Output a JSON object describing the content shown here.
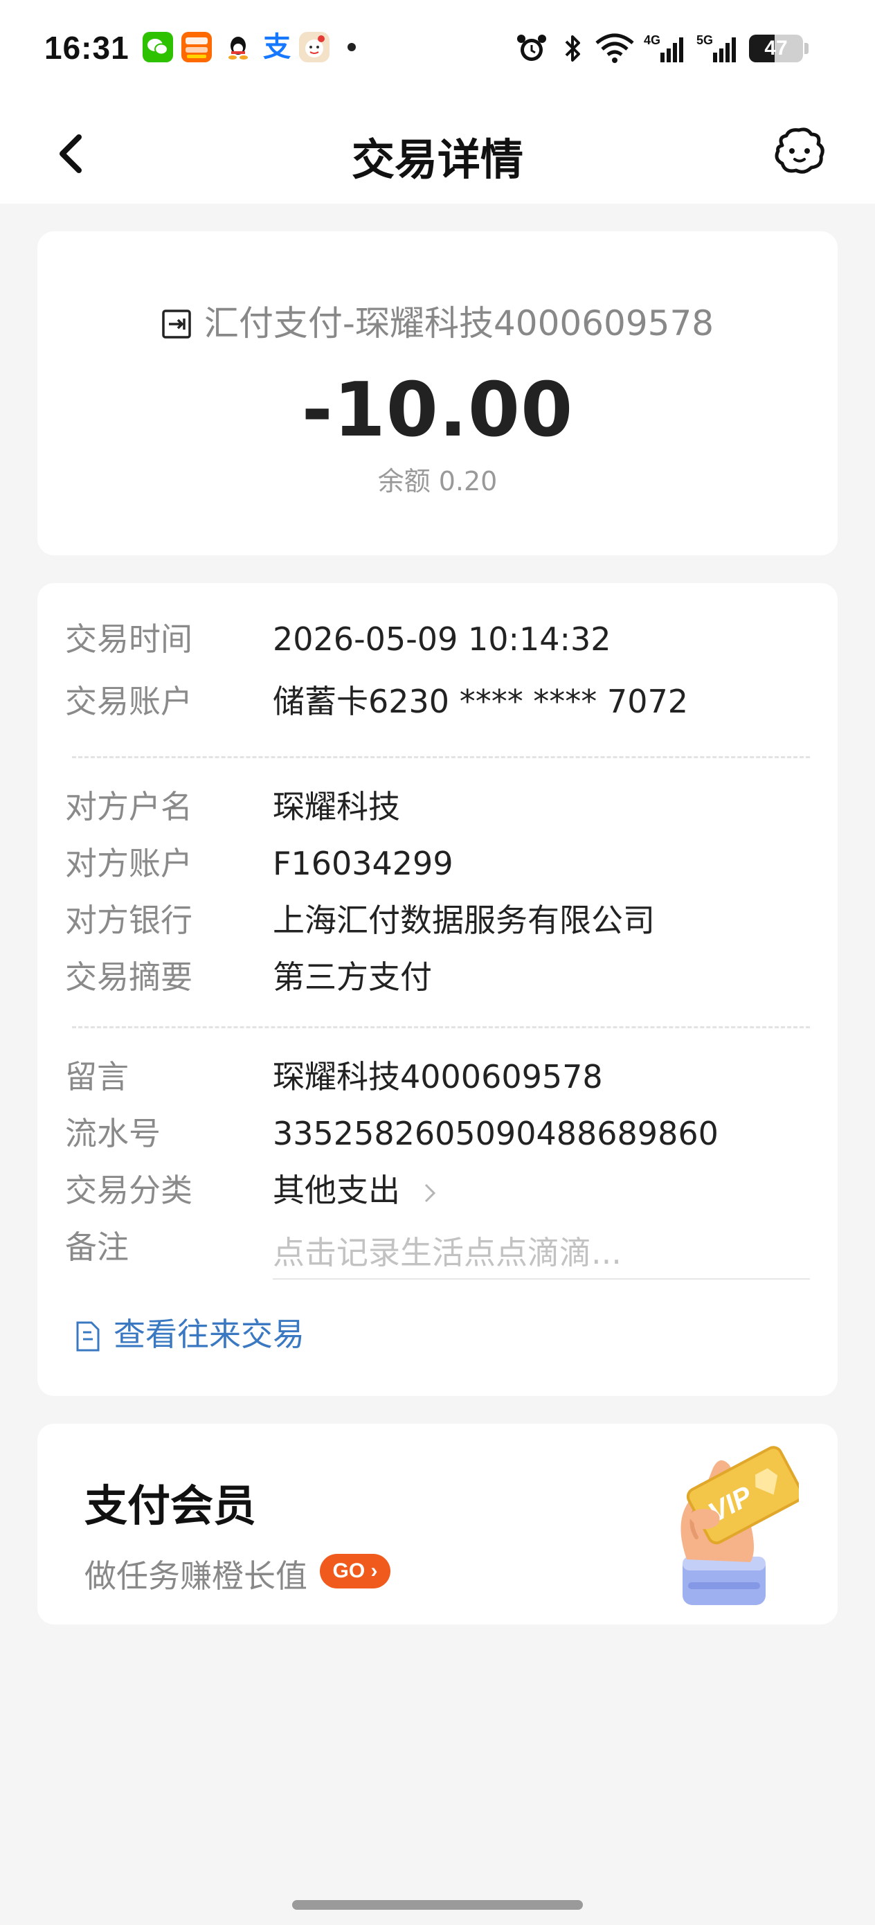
{
  "status_bar": {
    "time": "16:31",
    "battery_level": "47",
    "battery_fraction": 0.47,
    "notification_icons": [
      "wechat-icon",
      "taobao-icon",
      "qq-icon",
      "alipay-icon",
      "app-icon",
      "more-dot"
    ],
    "system_icons": [
      "alarm-icon",
      "bluetooth-icon",
      "wifi-icon",
      "signal-4g-icon",
      "signal-5g-icon",
      "battery-icon"
    ],
    "alipay_glyph": "支"
  },
  "nav": {
    "title": "交易详情",
    "back_icon": "chevron-left-icon",
    "service_icon": "customer-service-icon"
  },
  "summary": {
    "merchant": "汇付支付-琛耀科技4000609578",
    "amount": "-10.00",
    "balance_label": "余额",
    "balance_value": "0.20"
  },
  "details": {
    "group1": [
      {
        "label": "交易时间",
        "value": "2026-05-09 10:14:32"
      },
      {
        "label": "交易账户",
        "value": "储蓄卡6230 **** **** 7072"
      }
    ],
    "group2": [
      {
        "label": "对方户名",
        "value": "琛耀科技"
      },
      {
        "label": "对方账户",
        "value": "F16034299"
      },
      {
        "label": "对方银行",
        "value": "上海汇付数据服务有限公司"
      },
      {
        "label": "交易摘要",
        "value": "第三方支付"
      }
    ],
    "group3": [
      {
        "label": "留言",
        "value": "琛耀科技4000609578"
      },
      {
        "label": "流水号",
        "value": "335258260509048868986​0"
      },
      {
        "label": "交易分类",
        "value": "其他支出"
      },
      {
        "label": "备注",
        "placeholder": "点击记录生活点点滴滴..."
      }
    ],
    "view_link": "查看往来交易"
  },
  "promo": {
    "title": "支付会员",
    "subtitle": "做任务赚橙长值",
    "go_label": "GO",
    "badge_text": "VIP",
    "colors": {
      "go": "#f05a1c",
      "card": "#f3c64a",
      "cuff": "#a9b6f2"
    }
  },
  "colors": {
    "background": "#f5f5f5",
    "link": "#3a78c2",
    "label": "#8a8a8a",
    "value": "#222222"
  }
}
